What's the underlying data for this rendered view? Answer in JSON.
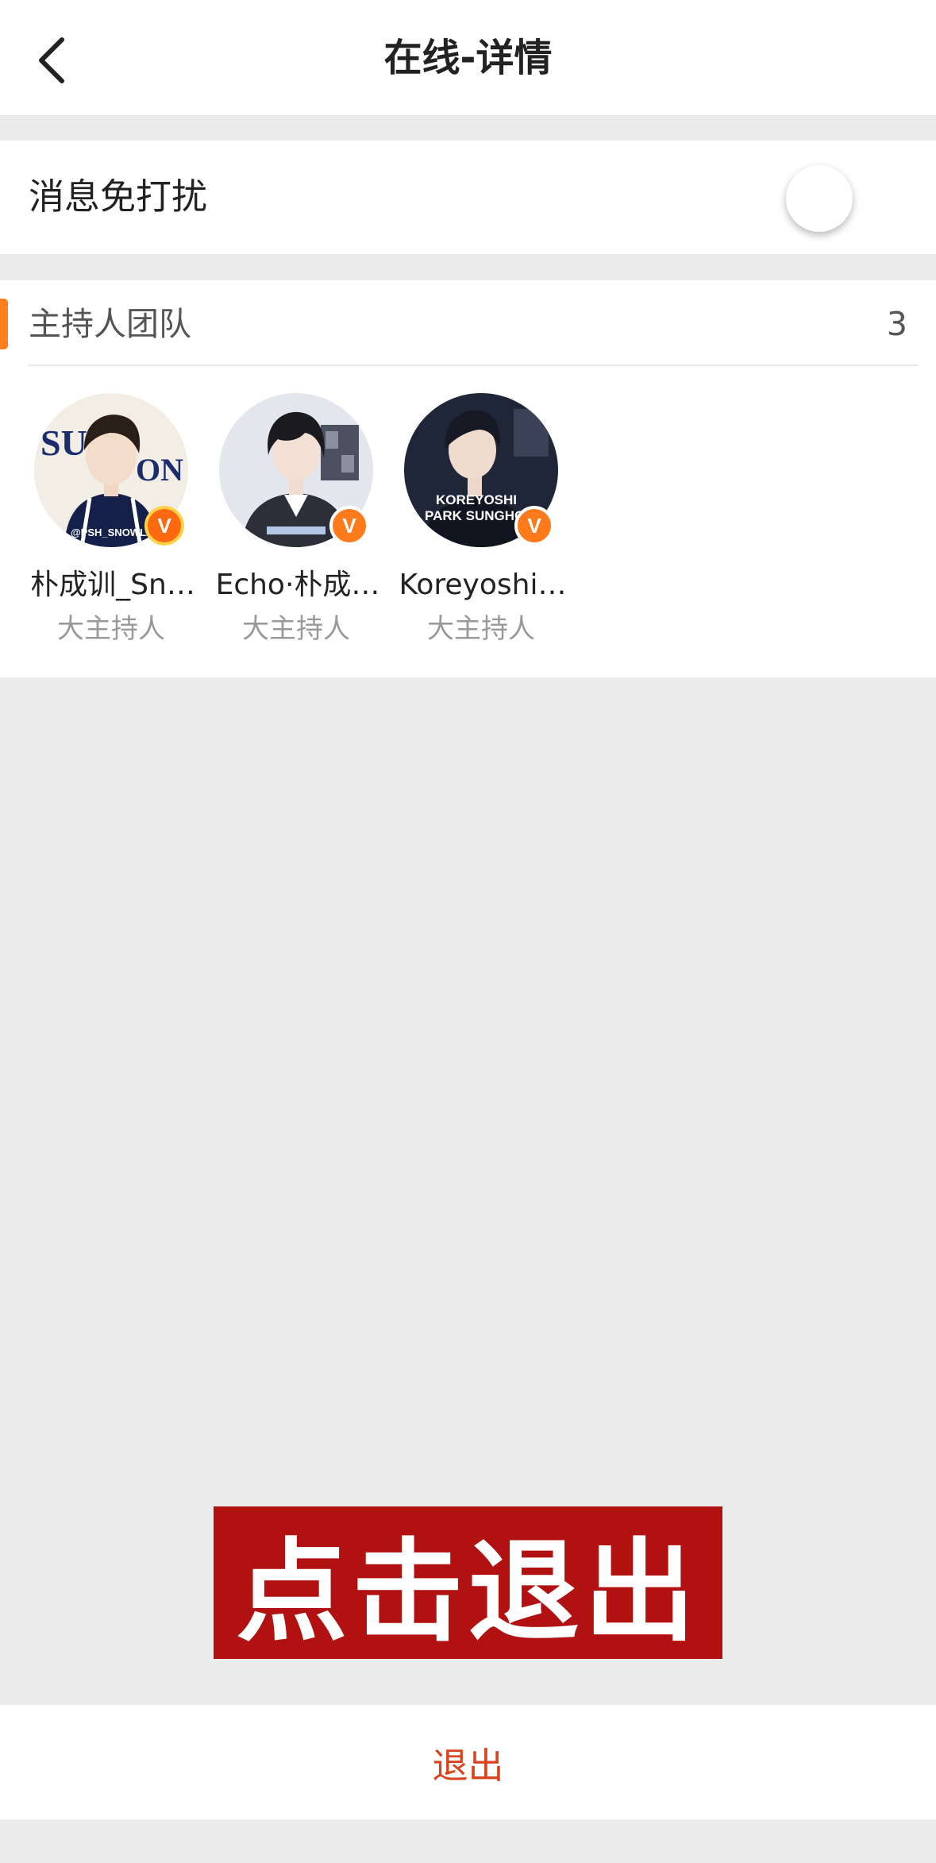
{
  "header": {
    "title": "在线-详情"
  },
  "do_not_disturb": {
    "label": "消息免打扰",
    "enabled": false
  },
  "host_team": {
    "title": "主持人团队",
    "count": "3",
    "accent_color": "#ff7f1f",
    "members": [
      {
        "name": "朴成训_Sn…",
        "role": "大主持人",
        "badge": "V",
        "avatar_text": "@PSH_SNOWLAND"
      },
      {
        "name": "Echo·朴成…",
        "role": "大主持人",
        "badge": "V"
      },
      {
        "name": "Koreyoshi…",
        "role": "大主持人",
        "badge": "V",
        "avatar_text": "KOREYOSHI PARK SUNGHOON"
      }
    ]
  },
  "banner": {
    "text": "点击退出",
    "color": "#b11111"
  },
  "exit_button": {
    "label": "退出",
    "color": "#d9441d"
  }
}
